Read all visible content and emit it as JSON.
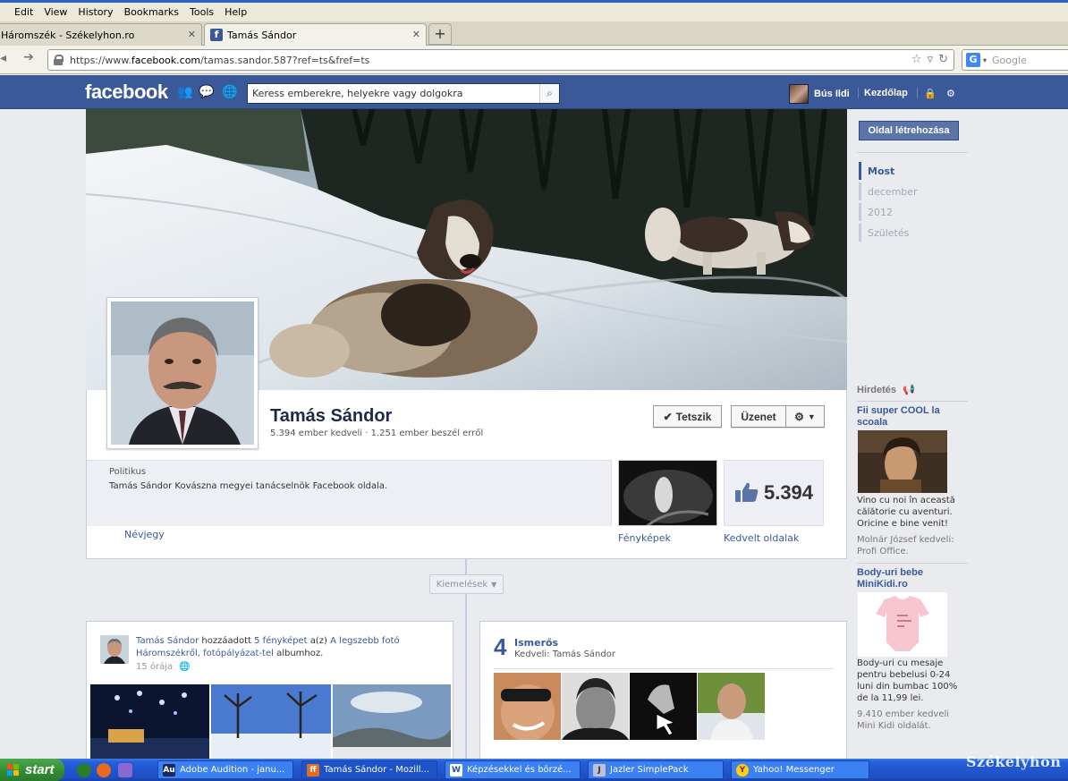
{
  "browser": {
    "menu": [
      "Edit",
      "View",
      "History",
      "Bookmarks",
      "Tools",
      "Help"
    ],
    "tabs": [
      {
        "label": "Háromszék - Székelyhon.ro",
        "active": false
      },
      {
        "label": "Tamás Sándor",
        "active": true
      }
    ],
    "new_tab_label": "+",
    "url_prefix": "https://www.",
    "url_domain": "facebook.com",
    "url_rest": "/tamas.sandor.587?ref=ts&fref=ts",
    "search_placeholder": "Google",
    "search_engine_icon": "G"
  },
  "fb": {
    "logo": "facebook",
    "search_placeholder": "Keress emberekre, helyekre vagy dolgokra",
    "user_name": "Bús Ildi",
    "home_label": "Kezdőlap",
    "brand_color": "#3b5998"
  },
  "profile": {
    "name": "Tamás Sándor",
    "stats": "5.394 ember kedveli · 1.251 ember beszél erről",
    "like_button": "Tetszik",
    "message_button": "Üzenet",
    "category": "Politikus",
    "description": "Tamás Sándor Kovászna megyei tanácselnök Facebook oldala.",
    "about_link": "Névjegy",
    "photos_link": "Fényképek",
    "likes_link": "Kedvelt oldalak",
    "likes_count": "5.394"
  },
  "timeline": {
    "create_page": "Oldal létrehozása",
    "nav": [
      {
        "label": "Most",
        "active": true
      },
      {
        "label": "december",
        "active": false
      },
      {
        "label": "2012",
        "active": false
      },
      {
        "label": "Születés",
        "active": false
      }
    ],
    "highlights": "Kiemelések"
  },
  "ads": {
    "header": "Hirdetés",
    "items": [
      {
        "title": "Fii super COOL la scoala",
        "text": "Vino cu noi în această călătorie cu aventuri. Oricine e bine venit!",
        "social": "Molnár József kedveli: Profi Office."
      },
      {
        "title": "Body-uri bebe MiniKidi.ro",
        "text": "Body-uri cu mesaje pentru bebelusi 0-24 luni din bumbac 100% de la 11,99 lei.",
        "social": "9.410 ember kedveli Mini Kidi oldalát."
      }
    ]
  },
  "post": {
    "author": "Tamás Sándor",
    "action": " hozzáadott ",
    "count_link": "5 fényképet",
    "to": " a(z) ",
    "album": "A legszebb fotó Háromszékről, fotópályázat-tel",
    "album_suffix": " albumhoz.",
    "time": "15 órája"
  },
  "friends": {
    "count": "4",
    "title": "Ismerős",
    "subtitle": "Kedveli: Tamás Sándor"
  },
  "taskbar": {
    "start": "start",
    "buttons": [
      {
        "label": "Adobe Audition - janu...",
        "icon": "Au"
      },
      {
        "label": "Tamás Sándor - Mozill...",
        "icon": "ff"
      },
      {
        "label": "Képzésekkel és börzé...",
        "icon": "W"
      },
      {
        "label": "Jazler SimplePack",
        "icon": "J"
      },
      {
        "label": "Yahoo! Messenger",
        "icon": "Y"
      }
    ],
    "watermark": "Székelyhon"
  }
}
